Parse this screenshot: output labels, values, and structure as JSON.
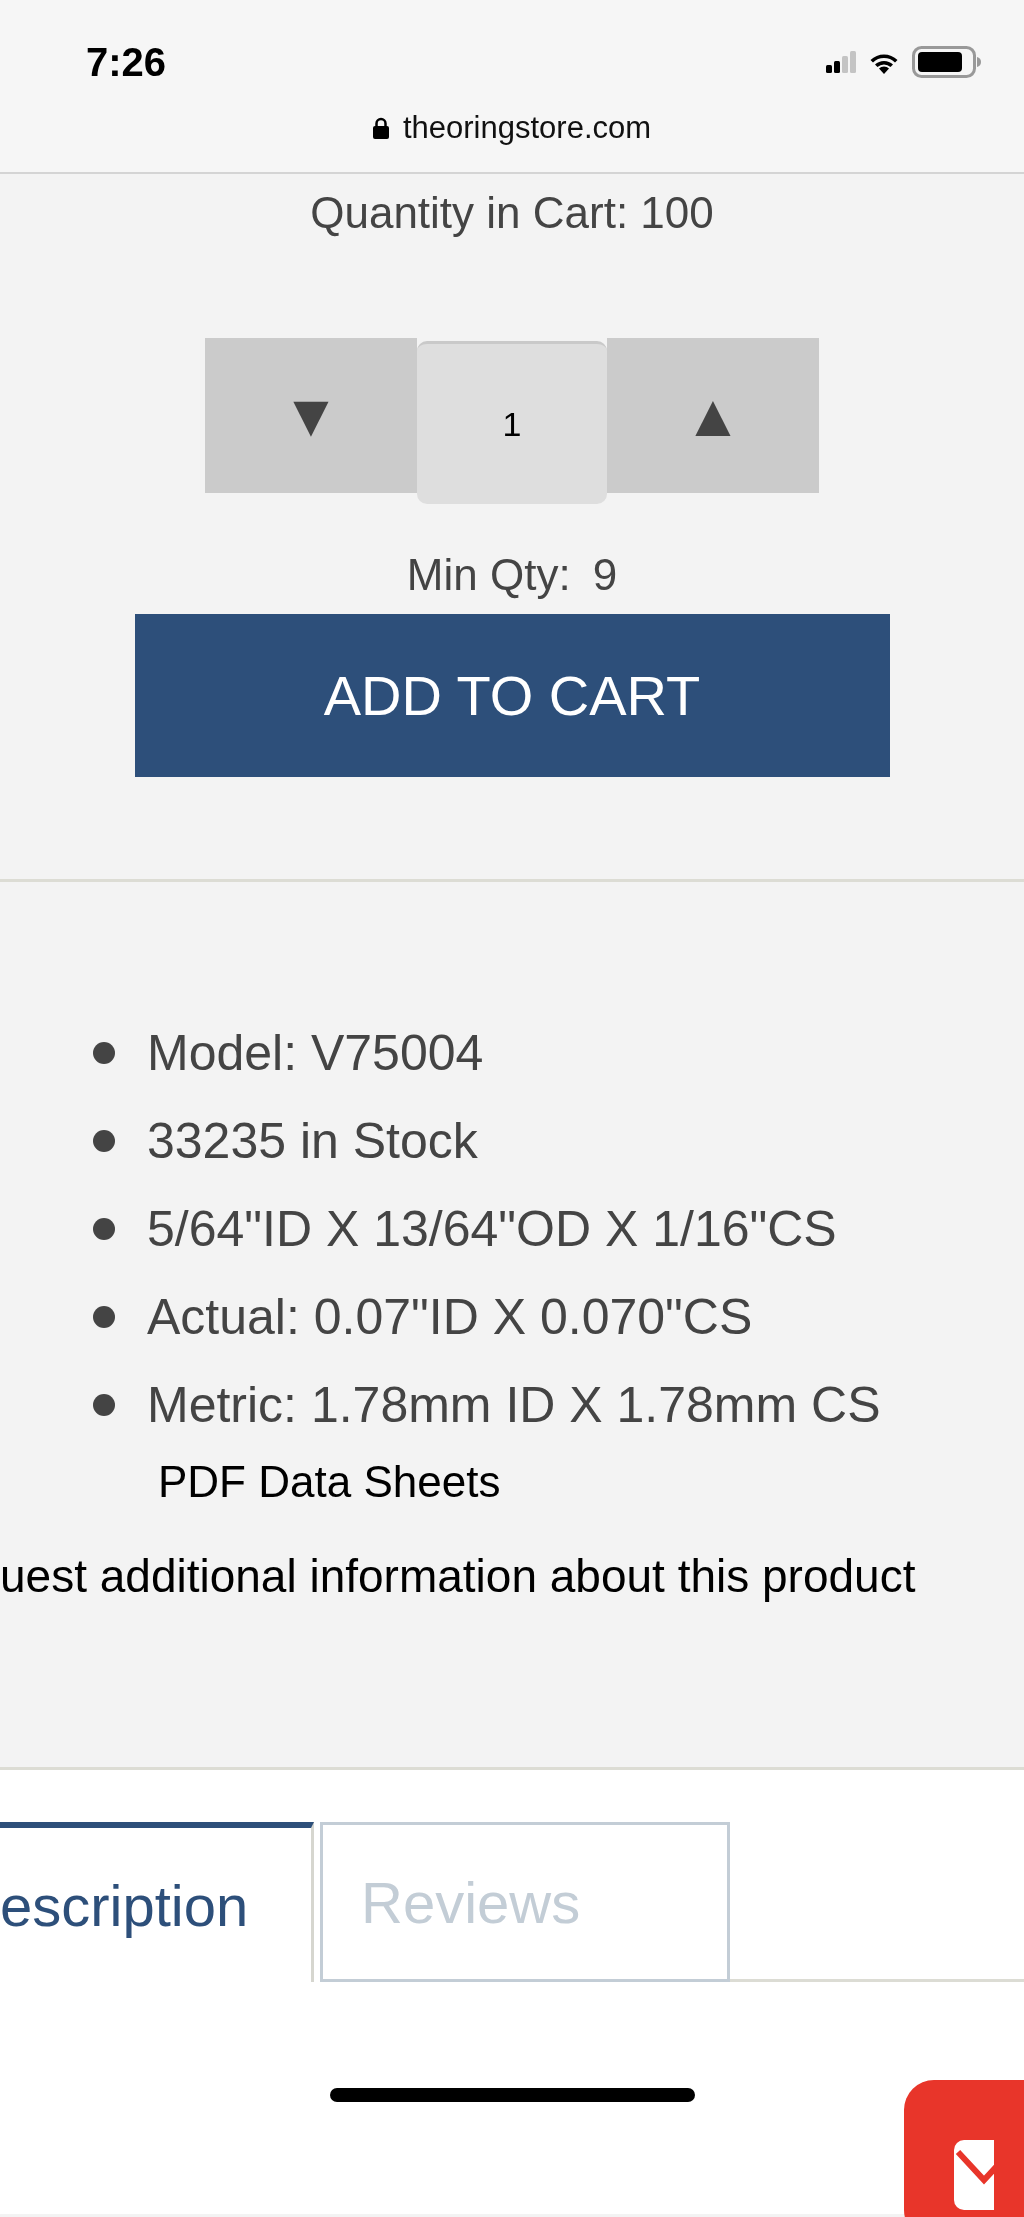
{
  "status_bar": {
    "time": "7:26"
  },
  "browser": {
    "url": "theoringstore.com"
  },
  "quantity_in_cart": "Quantity in Cart: 100",
  "stepper": {
    "decrease": "▼",
    "value": "1",
    "increase": "▲"
  },
  "min_qty": {
    "label": "Min Qty:",
    "value": "9"
  },
  "add_to_cart": "ADD TO CART",
  "specs": [
    "Model: V75004",
    "33235 in Stock",
    "5/64\"ID X 13/64\"OD X 1/16\"CS",
    "Actual: 0.07\"ID X 0.070\"CS",
    "Metric: 1.78mm ID X 1.78mm CS"
  ],
  "pdf_link": "PDF Data Sheets",
  "request_info_link": "uest additional information about this product",
  "tabs": [
    {
      "label": "escription",
      "selected": true
    },
    {
      "label": "Reviews",
      "selected": false
    }
  ]
}
